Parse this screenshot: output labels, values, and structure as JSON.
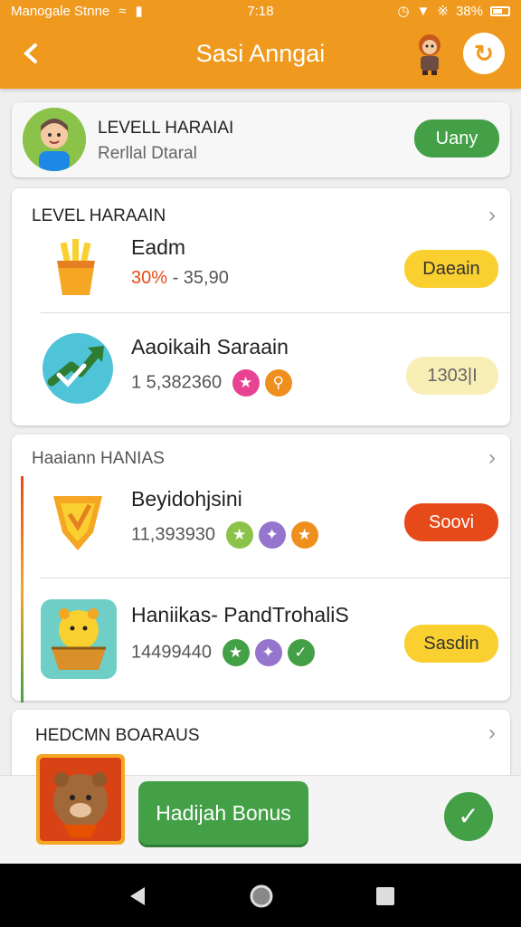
{
  "status_bar": {
    "carrier": "Manogale Stnne",
    "time": "7:18",
    "battery": "38%"
  },
  "app_bar": {
    "title": "Sasi Anngai"
  },
  "profile": {
    "name": "LEVELL HARAIAI",
    "subtitle": "Rerllal Dtaral",
    "button_label": "Uany"
  },
  "sections": [
    {
      "header": "LEVEL HARAAIN",
      "items": [
        {
          "title": "Eadm",
          "meta_highlight": "30%",
          "meta_rest": " - 35,90",
          "button": "Daeain"
        },
        {
          "title": "Aaoikaih Saraain",
          "meta_rest": "1 5,382360",
          "button": "1303|I"
        }
      ]
    },
    {
      "header": "Haaiann  HANIAS",
      "items": [
        {
          "title": "Beyidohjsini",
          "meta_rest": "11,393930",
          "button": "Soovi"
        },
        {
          "title": "Haniikas- PandTrohaliS",
          "meta_rest": "14499440",
          "button": "Sasdin"
        }
      ]
    },
    {
      "header": "HEDCMN  BOARAUS"
    }
  ],
  "bottom": {
    "bonus_button": "Hadijah Bonus"
  },
  "colors": {
    "brand_orange": "#ef9a1e",
    "green": "#43a047",
    "yellow": "#f9d02f",
    "red": "#e64a19"
  }
}
